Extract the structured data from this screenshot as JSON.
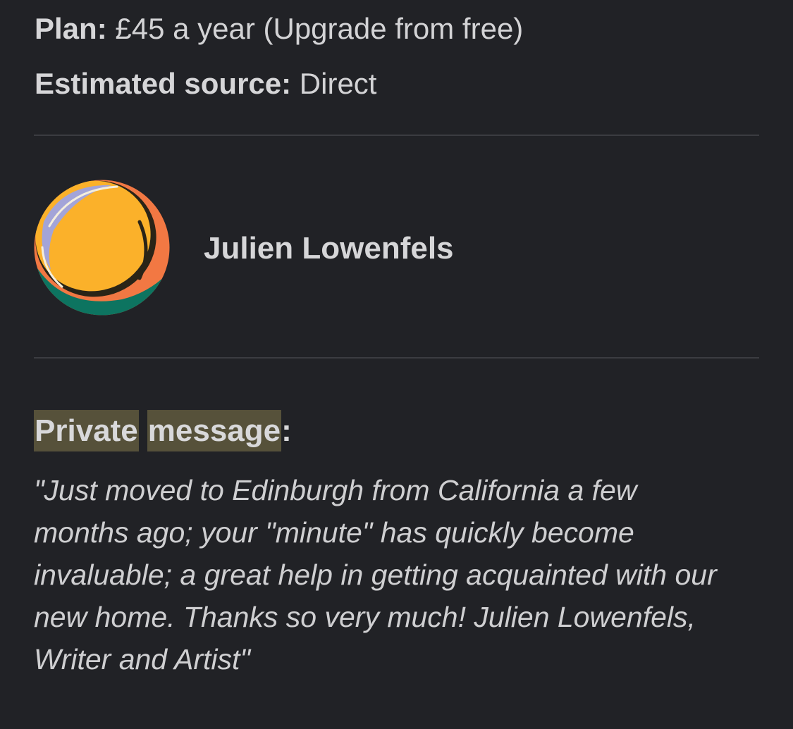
{
  "subscriber": {
    "plan_label": "Plan:",
    "plan_value": "£45 a year (Upgrade from free)",
    "source_label": "Estimated source:",
    "source_value": "Direct"
  },
  "author": {
    "name": "Julien Lowenfels",
    "avatar_icon": "abstract-sphere-avatar-icon",
    "avatar_colors": {
      "yellow": "#fbb12a",
      "green": "#0d7460",
      "orange": "#f27843",
      "lavender": "#a3a4d8",
      "dark": "#2a2417"
    }
  },
  "private_message": {
    "heading_word_1": "Private",
    "heading_word_2": "message",
    "heading_suffix": ":",
    "highlight_color": "#56513a",
    "body": "\"Just moved to Edinburgh from California a few months ago; your \"minute\" has quickly become invaluable; a great help in getting acquainted with our new home. Thanks so very much! Julien Lowenfels, Writer and Artist\""
  }
}
